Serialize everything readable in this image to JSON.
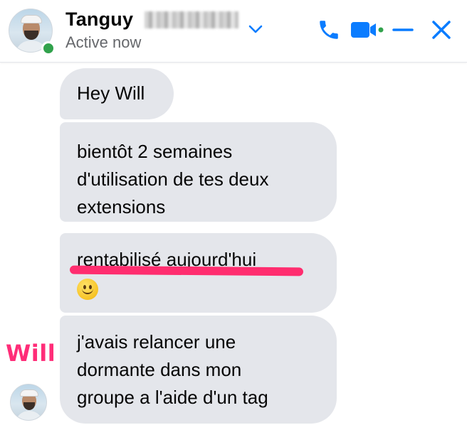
{
  "header": {
    "contact_name": "Tanguy",
    "status": "Active now",
    "accent_color": "#0a7cff",
    "presence_color": "#31a24c",
    "icons": [
      "phone-icon",
      "video-call-icon",
      "minimize-icon",
      "close-icon",
      "chevron-down-icon"
    ]
  },
  "messages": [
    {
      "text": "Hey Will"
    },
    {
      "lines": [
        "bientôt 2 semaines",
        "d'utilisation de tes deux",
        "extensions"
      ]
    },
    {
      "text": "rentabilisé aujourd'hui",
      "emoji": "slightly-smiling-face"
    },
    {
      "lines": [
        "j'avais relancer une",
        "dormante dans mon",
        "groupe a l'aide d'un tag"
      ]
    }
  ],
  "annotation": {
    "label": "Will",
    "color": "#ff2d78"
  }
}
